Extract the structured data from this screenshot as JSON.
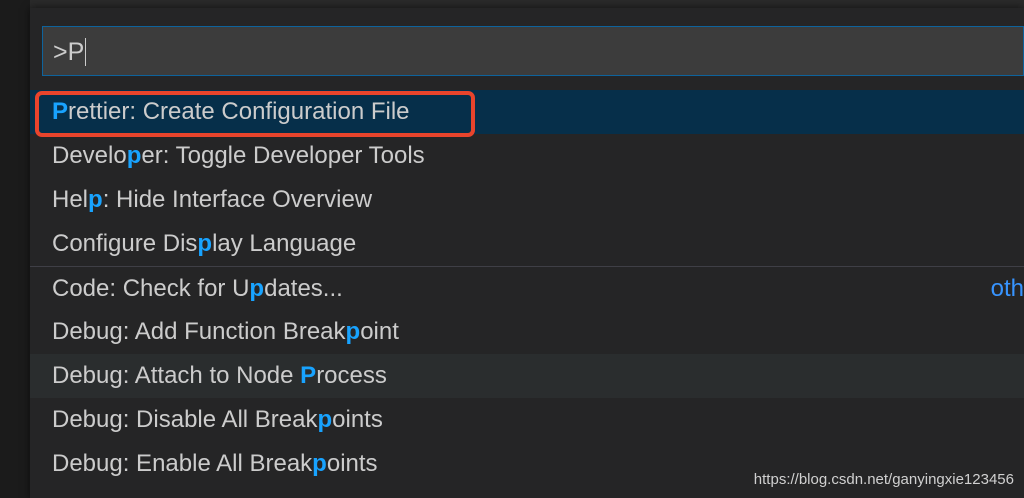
{
  "input": {
    "value": ">P"
  },
  "commands": [
    {
      "pre": "",
      "match": "P",
      "post": "rettier: Create Configuration File"
    },
    {
      "pre": "Develo",
      "match": "p",
      "post": "er: Toggle Developer Tools"
    },
    {
      "pre": "Hel",
      "match": "p",
      "post": ": Hide Interface Overview"
    },
    {
      "pre": "Configure Dis",
      "match": "p",
      "post": "lay Language"
    },
    {
      "pre": "Code: Check for U",
      "match": "p",
      "post": "dates...",
      "hint": "oth"
    },
    {
      "pre": "Debug: Add Function Break",
      "match": "p",
      "post": "oint"
    },
    {
      "pre": "Debug: Attach to Node ",
      "match": "P",
      "post": "rocess"
    },
    {
      "pre": "Debug: Disable All Break",
      "match": "p",
      "post": "oints"
    },
    {
      "pre": "Debug: Enable All Break",
      "match": "p",
      "post": "oints"
    }
  ],
  "watermark": "https://blog.csdn.net/ganyingxie123456",
  "colors": {
    "highlight": "#18a3ff",
    "selected_row": "#062f4a",
    "annotation_box": "#e8442c"
  }
}
